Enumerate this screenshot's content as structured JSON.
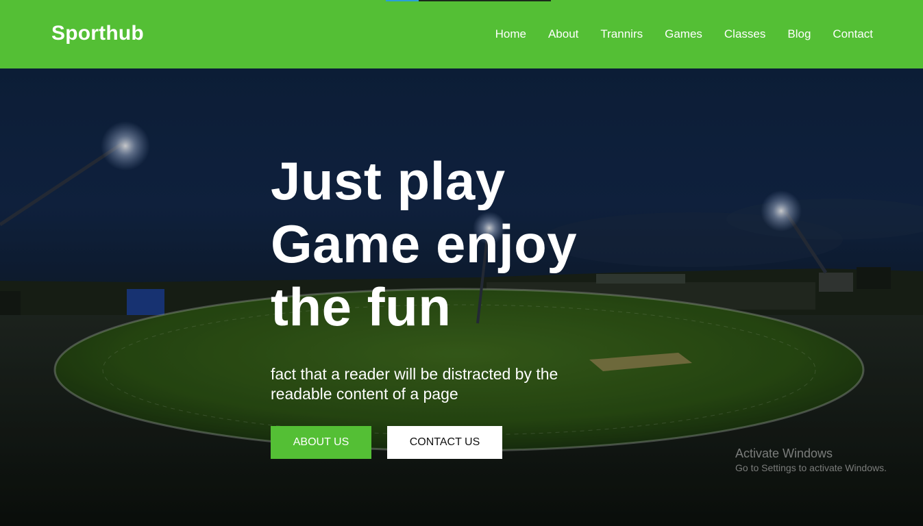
{
  "brand": {
    "name": "Sporthub"
  },
  "nav": {
    "items": [
      {
        "label": "Home"
      },
      {
        "label": "About"
      },
      {
        "label": "Trannirs"
      },
      {
        "label": "Games"
      },
      {
        "label": "Classes"
      },
      {
        "label": "Blog"
      },
      {
        "label": "Contact"
      }
    ]
  },
  "hero": {
    "headline_line1": "Just play",
    "headline_line2": "Game enjoy",
    "headline_line3": "the fun",
    "subtext_line1": "fact that a reader will be distracted by the",
    "subtext_line2": "readable content of a page",
    "primary_button": "ABOUT US",
    "secondary_button": "CONTACT US"
  },
  "watermark": {
    "title": "Activate Windows",
    "subtitle": "Go to Settings to activate Windows."
  },
  "colors": {
    "brand_green": "#54bf35",
    "white": "#ffffff",
    "night_sky": "#0f2443"
  },
  "background_image": "night cricket stadium with floodlights"
}
